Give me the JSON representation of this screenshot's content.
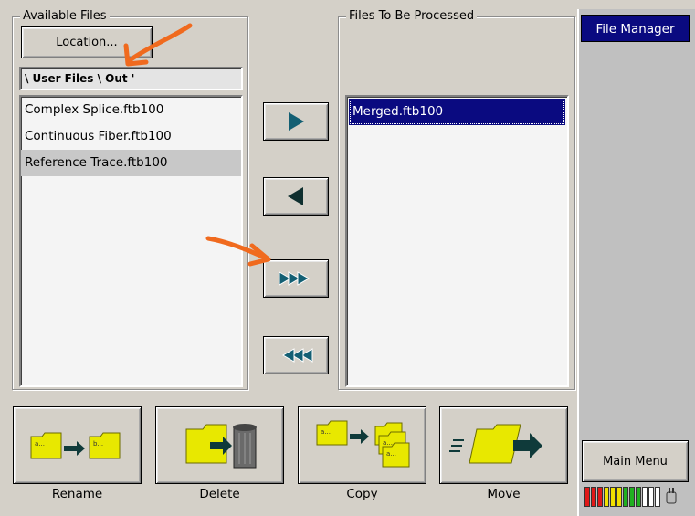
{
  "available_files": {
    "legend": "Available Files",
    "location_button": "Location...",
    "path": "\\ User Files \\ Out '",
    "files": [
      {
        "name": "Complex Splice.ftb100",
        "selected": false
      },
      {
        "name": "Continuous Fiber.ftb100",
        "selected": false
      },
      {
        "name": "Reference Trace.ftb100",
        "selected": true
      }
    ]
  },
  "to_process": {
    "legend": "Files To Be Processed",
    "files": [
      {
        "name": "Merged.ftb100",
        "selected": true
      }
    ]
  },
  "transfer_buttons": {
    "add_one": "play-right-icon",
    "remove_one": "play-left-icon",
    "add_all": "fast-forward-icon",
    "remove_all": "fast-rewind-icon"
  },
  "actions": {
    "rename_label": "Rename",
    "delete_label": "Delete",
    "copy_label": "Copy",
    "move_label": "Move"
  },
  "sidebar": {
    "title": "File Manager",
    "main_menu_label": "Main Menu"
  },
  "battery_meter": {
    "segments": [
      "red",
      "red",
      "red",
      "yellow",
      "yellow",
      "yellow",
      "green",
      "green",
      "green",
      "white",
      "white",
      "white"
    ]
  },
  "colors": {
    "highlight": "#0a0a80",
    "folder": "#e8e800",
    "arrow": "#0f3a3a",
    "annotation": "#f06a1e"
  }
}
